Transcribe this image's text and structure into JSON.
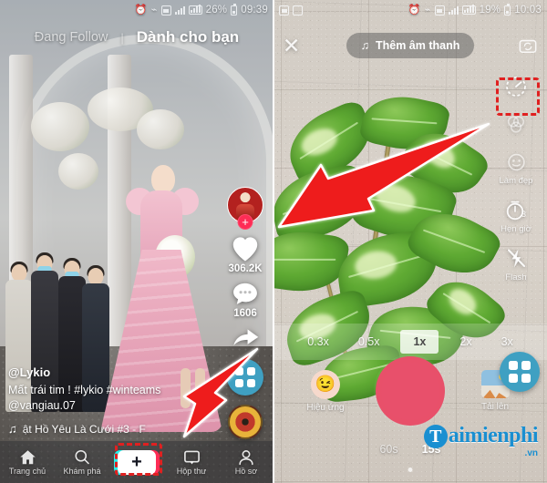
{
  "left_phone": {
    "statusbar": {
      "icons": [
        "alarm-icon",
        "wifi-off-icon",
        "sim-icon",
        "signal-icon",
        "signal2-icon"
      ],
      "battery_percent": "26%",
      "time": "09:39"
    },
    "header": {
      "tab_following": "Đang Follow",
      "separator": "|",
      "tab_active": "Dành cho bạn"
    },
    "rail": {
      "follow_plus": "+",
      "like_count": "306.2K",
      "comment_count": "1606",
      "share_label": "",
      "grid_label": ""
    },
    "caption": {
      "username": "@Lykio",
      "text": "Mất trái tim ! #lykio #winteams @vangiau.07",
      "music": "ật Hồ   Yêu Là Cưới #3 - F"
    },
    "bottom_nav": [
      {
        "label": "Trang chủ",
        "icon": "home-icon"
      },
      {
        "label": "Khám phá",
        "icon": "search-icon"
      },
      {
        "label": "",
        "icon": "plus-icon"
      },
      {
        "label": "Hộp thư",
        "icon": "inbox-icon"
      },
      {
        "label": "Hồ sơ",
        "icon": "profile-icon"
      }
    ],
    "plus_button_glyph": "+"
  },
  "right_phone": {
    "statusbar": {
      "left_icons": [
        "screenshot-icon",
        "screen-record-icon"
      ],
      "icons": [
        "alarm-icon",
        "wifi-icon",
        "sim-icon",
        "signal-icon",
        "signal2-icon"
      ],
      "battery_percent": "19%",
      "time": "10:03"
    },
    "topbar": {
      "close": "✕",
      "sound_button": "Thêm âm thanh",
      "sound_icon": "music-note-icon",
      "flip_camera_icon": "flip-camera-icon"
    },
    "tools": [
      {
        "label": "",
        "icon": "speed-dial-icon",
        "highlighted": true
      },
      {
        "label": "",
        "icon": "filter-icon",
        "highlighted": false
      },
      {
        "label": "Làm đẹp",
        "icon": "beauty-icon",
        "highlighted": false
      },
      {
        "label": "Hẹn giờ",
        "icon": "timer-icon",
        "highlighted": false
      },
      {
        "label": "Flash",
        "icon": "flash-off-icon",
        "highlighted": false
      }
    ],
    "zoom_levels": [
      {
        "label": "0.3x",
        "active": false
      },
      {
        "label": "0.5x",
        "active": false
      },
      {
        "label": "1x",
        "active": true
      },
      {
        "label": "2x",
        "active": false
      },
      {
        "label": "3x",
        "active": false
      }
    ],
    "bottom": {
      "effects_label": "Hiệu ứng",
      "effects_icon": "smiley-icon",
      "upload_label": "Tải lên",
      "upload_icon": "image-icon",
      "shutter_label": "record-button"
    },
    "modes": [
      {
        "label": "60s",
        "active": false
      },
      {
        "label": "15s",
        "active": true
      }
    ]
  },
  "watermark": {
    "initial": "T",
    "main": "aimienphi",
    "domain": ".vn"
  },
  "annotations": {
    "arrow_to_speed_dial": "red-arrow",
    "arrow_to_plus_button": "red-arrow",
    "highlight_color": "#e02020"
  },
  "colors": {
    "accent_blue": "#3fa0c2",
    "tiktok_pink": "#fe2c55",
    "tiktok_cyan": "#25f4ee",
    "shutter_red": "#e8506b",
    "watermark_blue": "#1a8fd1"
  }
}
